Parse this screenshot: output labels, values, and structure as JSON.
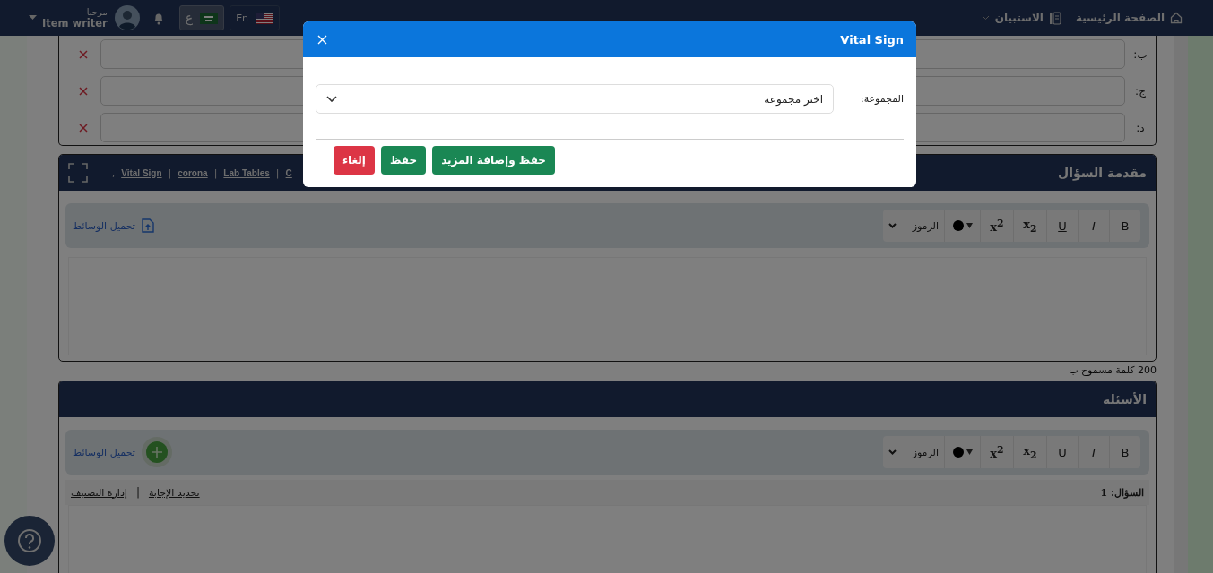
{
  "navbar": {
    "nav_items": [
      {
        "label": "الصفحة الرئيسية",
        "dropdown": false
      },
      {
        "label": "الاستبيان",
        "dropdown": true
      }
    ],
    "languages": [
      {
        "label": "En",
        "selected": false
      },
      {
        "label": "ع",
        "selected": true
      }
    ],
    "greeting": "مرحبا",
    "user_name": "Item writer"
  },
  "answer_options": [
    {
      "label": "ب:"
    },
    {
      "label": "ج:"
    },
    {
      "label": "د:"
    }
  ],
  "intro_section": {
    "title": "مقدمة السؤال",
    "tags": [
      "C",
      "Lab Tables",
      "corona",
      "Vital Sign"
    ],
    "separator": "|",
    "tags_end": ",",
    "toolbar": {
      "buttons": [
        {
          "label": "B",
          "kind": "bold"
        },
        {
          "label": "I",
          "kind": "italic"
        },
        {
          "label": "U",
          "kind": "underline"
        },
        {
          "label": "x$_{2}$",
          "kind": "subscript"
        },
        {
          "label": "x$^{2}$",
          "kind": "superscript"
        }
      ],
      "symbols_label": "الرموز",
      "upload_label": "تحميل الوسائط"
    }
  },
  "word_limit": "200 كلمة مسموح ب",
  "questions_section": {
    "title": "الأسئلة",
    "toolbar": {
      "buttons": [
        {
          "label": "B",
          "kind": "bold"
        },
        {
          "label": "I",
          "kind": "italic"
        },
        {
          "label": "U",
          "kind": "underline"
        },
        {
          "label": "x$_{2}$",
          "kind": "subscript"
        },
        {
          "label": "x$^{2}$",
          "kind": "superscript"
        }
      ],
      "symbols_label": "الرموز",
      "upload_label": "تحميل الوسائط"
    },
    "question_label": "السؤال: 1",
    "links": [
      "تحديد الإجابة",
      "إدارة التصنيف"
    ],
    "separator": "|"
  },
  "modal": {
    "title": "Vital Sign",
    "field_label": "المجموعة:",
    "value": "اختر مجموعة",
    "buttons": [
      {
        "label": "حفظ وإضافة المزيد",
        "kind": "success"
      },
      {
        "label": "حفظ",
        "kind": "success"
      },
      {
        "label": "إلغاء",
        "kind": "danger"
      }
    ]
  }
}
